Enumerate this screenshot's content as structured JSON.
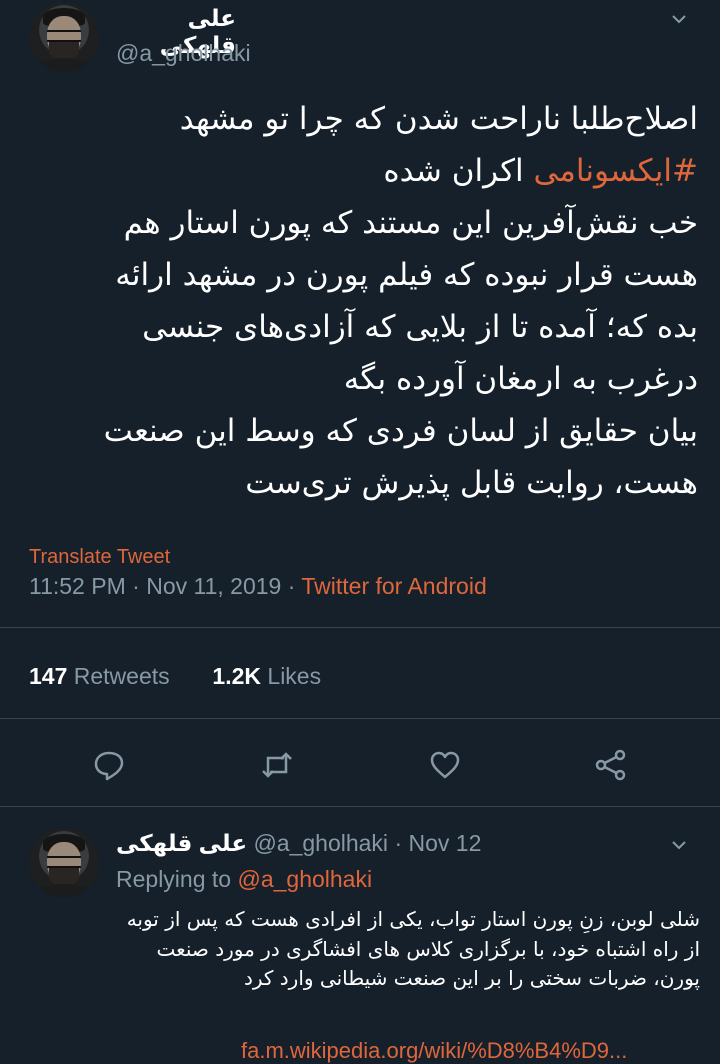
{
  "tweet": {
    "author_name": "علی قلهکی",
    "author_handle": "@a_gholhaki",
    "text_line1": "اصلاح‌طلبا ناراحت شدن که چرا تو مشهد",
    "hashtag": "#ایکسونامی",
    "text_after_hashtag": " اکران شده",
    "text_rest": "خب نقش‌آفرین این مستند که پورن استار هم\nهست قرار نبوده که فیلم پورن در مشهد ارائه\nبده که؛ آمده تا از بلایی که آزادی‌های جنسی\nدرغرب به ارمغان آورده بگه\nبیان حقایق از لسان فردی که وسط این صنعت\nهست، روایت قابل پذیرش تری‌ست",
    "translate_label": "Translate Tweet",
    "time": "11:52 PM",
    "date": "Nov 11, 2019",
    "separator": "·",
    "source": "Twitter for Android",
    "retweets_count": "147",
    "retweets_label": "Retweets",
    "likes_count": "1.2K",
    "likes_label": "Likes"
  },
  "reply": {
    "author_name": "علی قلهکی",
    "author_handle": "@a_gholhaki",
    "separator": "·",
    "date": "Nov 12",
    "replying_label": "Replying to",
    "replying_to": "@a_gholhaki",
    "text": "شلی لوبن، زنِ پورن استار تواب، یکی از افرادی هست که پس از توبه از راه اشتباه خود، با برگزاری کلاس های افشاگری در مورد صنعت پورن، ضربات سختی را بر این صنعت شیطانی وارد کرد",
    "link": "fa.m.wikipedia.org/wiki/%D8%B4%D9..."
  },
  "colors": {
    "background": "#15202b",
    "accent": "#e0663b",
    "secondary_text": "#8899a6",
    "divider": "#38444d"
  },
  "icons": [
    "chevron-down-icon",
    "reply-icon",
    "retweet-icon",
    "like-icon",
    "share-icon"
  ]
}
